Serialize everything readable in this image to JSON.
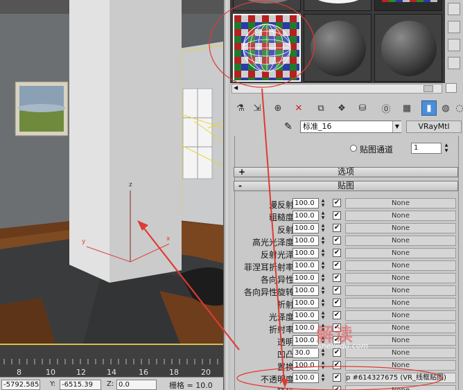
{
  "viewport": {
    "axis_z": "z",
    "axis_y": "y",
    "axis_x": "x"
  },
  "timeline": {
    "ticks": [
      "8",
      "10",
      "12",
      "14",
      "16",
      "18",
      "20"
    ]
  },
  "status": {
    "x_value": "-5792.585",
    "y_label": "Y:",
    "y_value": "-6515.39",
    "z_label": "Z:",
    "z_value": "0.0",
    "grid": "栅格 = 10.0"
  },
  "material": {
    "name": "标准_16",
    "type": "VRayMtl",
    "map_channel_label": "贴图通道",
    "map_channel_value": "1"
  },
  "rollouts": {
    "options": {
      "sign": "+",
      "title": "选项"
    },
    "maps": {
      "sign": "-",
      "title": "贴图"
    }
  },
  "maps": [
    {
      "label": "漫反射",
      "value": "100.0",
      "checked": "✔",
      "map": "None"
    },
    {
      "label": "粗糙度",
      "value": "100.0",
      "checked": "✔",
      "map": "None"
    },
    {
      "label": "反射",
      "value": "100.0",
      "checked": "✔",
      "map": "None"
    },
    {
      "label": "高光光泽度",
      "value": "100.0",
      "checked": "✔",
      "map": "None"
    },
    {
      "label": "反射光泽",
      "value": "100.0",
      "checked": "✔",
      "map": "None"
    },
    {
      "label": "菲涅耳折射率",
      "value": "100.0",
      "checked": "✔",
      "map": "None"
    },
    {
      "label": "各向异性",
      "value": "100.0",
      "checked": "✔",
      "map": "None"
    },
    {
      "label": "各向异性旋转",
      "value": "100.0",
      "checked": "✔",
      "map": "None"
    },
    {
      "label": "折射",
      "value": "100.0",
      "checked": "✔",
      "map": "None"
    },
    {
      "label": "光泽度",
      "value": "100.0",
      "checked": "✔",
      "map": "None"
    },
    {
      "label": "折射率",
      "value": "100.0",
      "checked": "✔",
      "map": "None"
    },
    {
      "label": "透明",
      "value": "100.0",
      "checked": "✔",
      "map": "None"
    },
    {
      "label": "凹凸",
      "value": "30.0",
      "checked": "✔",
      "map": "None"
    },
    {
      "label": "置换",
      "value": "100.0",
      "checked": "✔",
      "map": "None"
    },
    {
      "label": "不透明度",
      "value": "100.0",
      "checked": "✔",
      "map": "p #614327675 (VR_线框贴图)"
    },
    {
      "label": "环境",
      "value": "",
      "checked": "✔",
      "map": "None"
    }
  ],
  "watermark": {
    "big": "解读",
    "small": "shelledu.com"
  },
  "colors": {
    "accent": "#4b8fdb",
    "annotation": "#e03a32",
    "floor": "#5a3015"
  }
}
